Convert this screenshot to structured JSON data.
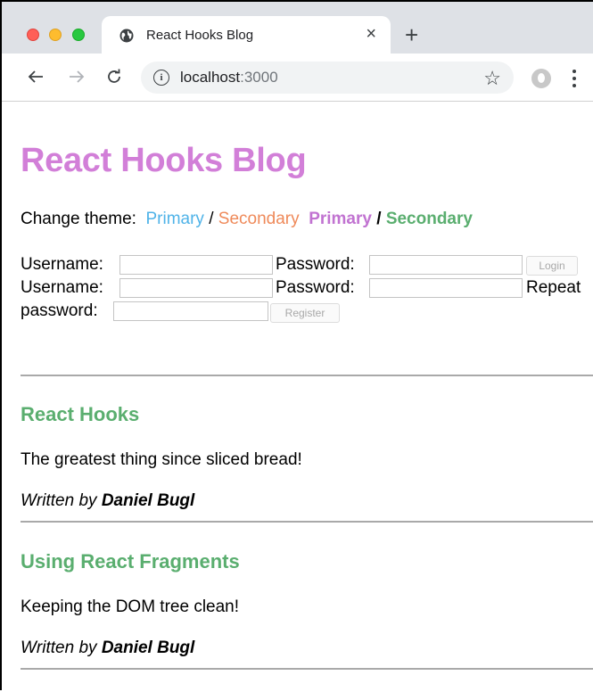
{
  "browser": {
    "tab_title": "React Hooks Blog",
    "close_glyph": "×",
    "new_tab_glyph": "+",
    "url_host": "localhost",
    "url_port": ":3000",
    "star_glyph": "☆",
    "info_glyph": "i"
  },
  "page": {
    "title": "React Hooks Blog",
    "theme": {
      "label": "Change theme:",
      "primary_light": "Primary",
      "secondary_light": "Secondary",
      "primary_bold": "Primary",
      "secondary_bold": "Secondary",
      "separator": "/",
      "colors": {
        "title": "#d27fd8",
        "primary_light": "#4fb3e8",
        "secondary_light": "#ef8a5a",
        "primary_bold": "#c173d1",
        "secondary_bold": "#5aae6f"
      }
    },
    "login": {
      "username_label": "Username:",
      "password_label": "Password:",
      "username_value": "",
      "password_value": "",
      "button_label": "Login"
    },
    "register": {
      "username_label": "Username:",
      "password_label": "Password:",
      "repeat_label_1": "Repeat",
      "repeat_label_2": "password:",
      "username_value": "",
      "password_value": "",
      "repeat_value": "",
      "button_label": "Register"
    },
    "posts": [
      {
        "title": "React Hooks",
        "content": "The greatest thing since sliced bread!",
        "written_by": "Written by",
        "author": "Daniel Bugl"
      },
      {
        "title": "Using React Fragments",
        "content": "Keeping the DOM tree clean!",
        "written_by": "Written by",
        "author": "Daniel Bugl"
      }
    ]
  }
}
